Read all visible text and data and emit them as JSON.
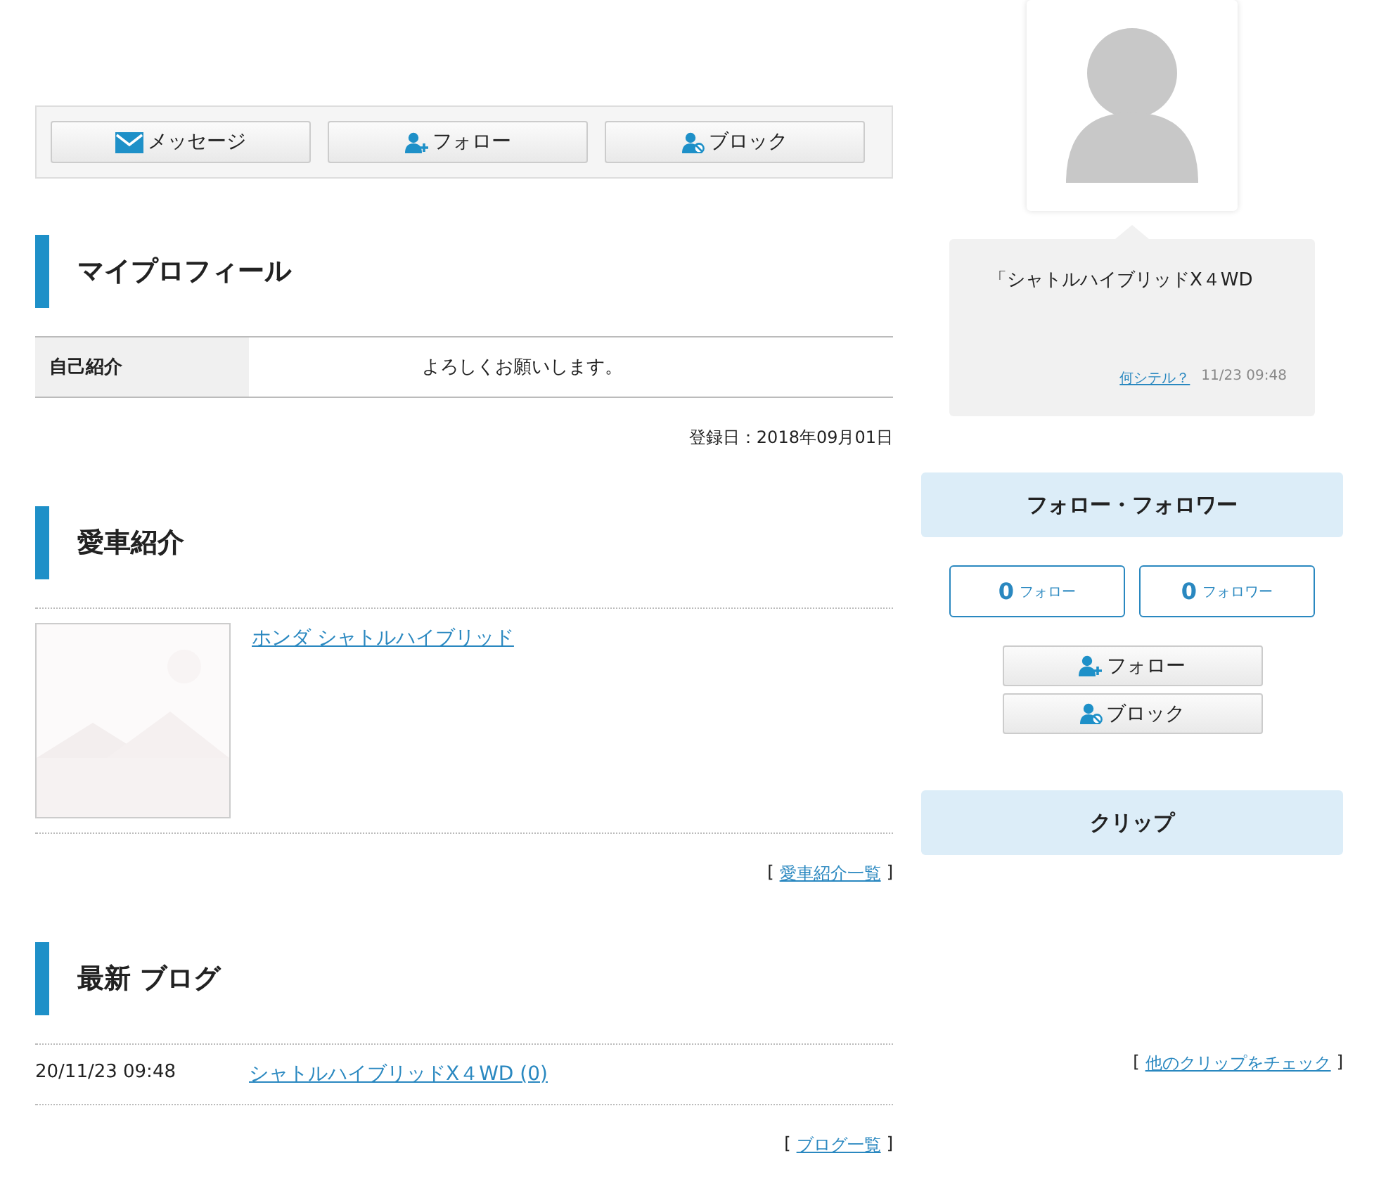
{
  "action_bar": [
    {
      "kind": "message",
      "label": "メッセージ"
    },
    {
      "kind": "follow",
      "label": "フォロー"
    },
    {
      "kind": "block",
      "label": "ブロック"
    }
  ],
  "profile": {
    "title": "マイプロフィール",
    "rows": [
      {
        "label": "自己紹介",
        "value": "よろしくお願いします。"
      }
    ],
    "registered": "登録日：2018年09月01日"
  },
  "cars": {
    "title": "愛車紹介",
    "items": [
      {
        "name": "ホンダ シャトルハイブリッド",
        "kind": "picture"
      }
    ],
    "more_link": {
      "open": "[",
      "label": "愛車紹介一覧",
      "close": "]"
    }
  },
  "blog": {
    "title": "最新 ブログ",
    "items": [
      {
        "date": "20/11/23 09:48",
        "title": "シャトルハイブリッドX４WD (0)"
      }
    ],
    "more_link": {
      "open": "[",
      "label": "ブログ一覧",
      "close": "]"
    }
  },
  "status_bubble": {
    "text": "「シャトルハイブリッドX４WD",
    "link": "何シテル？",
    "time": "11/23 09:48"
  },
  "follow_panel": {
    "title": "フォロー・フォロワー",
    "counts": [
      {
        "count": "0",
        "label": "フォロー"
      },
      {
        "count": "0",
        "label": "フォロワー"
      }
    ],
    "buttons": [
      {
        "kind": "follow",
        "label": "フォロー"
      },
      {
        "kind": "block",
        "label": "ブロック"
      }
    ]
  },
  "clip_panel": {
    "title": "クリップ",
    "more_link": {
      "open": "[",
      "label": "他のクリップをチェック",
      "close": "]"
    }
  }
}
